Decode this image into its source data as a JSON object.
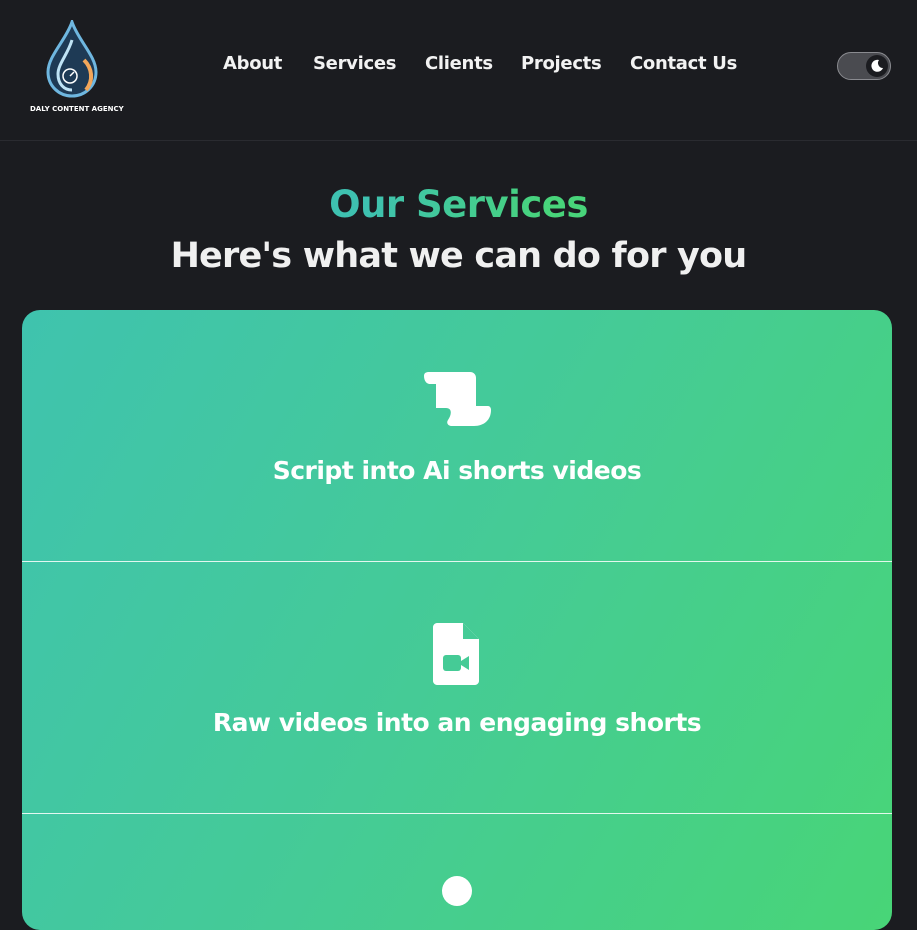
{
  "brand": {
    "name": "DALY CONTENT AGENCY"
  },
  "nav": {
    "items": [
      {
        "label": "About"
      },
      {
        "label": "Services"
      },
      {
        "label": "Clients"
      },
      {
        "label": "Projects"
      },
      {
        "label": "Contact Us"
      }
    ]
  },
  "theme_toggle": {
    "mode": "dark",
    "icon": "moon-icon"
  },
  "services": {
    "title": "Our Services",
    "subtitle": "Here's what we can do for you",
    "cards": [
      {
        "icon": "scroll-icon",
        "title": "Script into Ai shorts videos"
      },
      {
        "icon": "video-file-icon",
        "title": "Raw videos into an engaging shorts"
      },
      {
        "icon": "circle-icon",
        "title": ""
      }
    ]
  },
  "colors": {
    "background": "#1b1c20",
    "accent_teal": "#3ec1b0",
    "accent_green": "#48d47a"
  }
}
